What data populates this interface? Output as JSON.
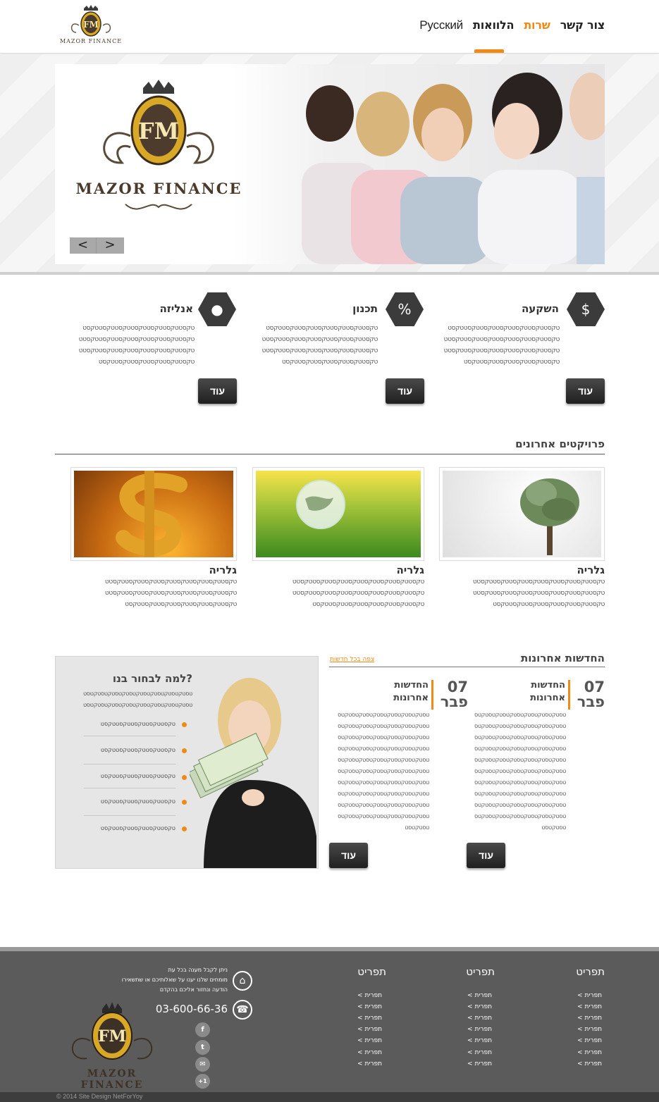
{
  "header": {
    "logo_text": "MAZOR FINANCE",
    "logo_monogram": "FM",
    "nav": [
      {
        "label": "צור קשר",
        "active": false
      },
      {
        "label": "שרות",
        "active": true
      },
      {
        "label": "הלוואות",
        "active": false
      },
      {
        "label": "Русский",
        "active": false
      }
    ]
  },
  "slider": {
    "logo_text": "MAZOR FINANCE",
    "logo_monogram": "FM",
    "prev_label": "<",
    "next_label": ">"
  },
  "features": [
    {
      "title": "השקעה",
      "icon": "money-bag-icon",
      "lines": [
        "טקסטטקסטטקסטטקסטטקסטטקסטטקסט",
        "טקסטטקסטטקסטטקסטטקסטטקסטטקסטט",
        "טקסטטקסטטקסטטקסטטקסטטקסטטקסטט",
        "טקסטטקסטטקסטטקסטטקסטטקסט"
      ],
      "button": "עוד"
    },
    {
      "title": "תכנון",
      "icon": "calculator-icon",
      "lines": [
        "טקסטטקסטטקסטטקסטטקסטטקסטטקסט",
        "טקסטטקסטטקסטטקסטטקסטטקסטטקסטט",
        "טקסטטקסטטקסטטקסטטקסטטקסטטקסטט",
        "טקסטטקסטטקסטטקסטטקסטטקסט"
      ],
      "button": "עוד"
    },
    {
      "title": "אנליזה",
      "icon": "piggy-bank-icon",
      "lines": [
        "טקסטטקסטטקסטטקסטטקסטטקסטטקסט",
        "טקסטטקסטטקסטטקסטטקסטטקסטטקסטט",
        "טקסטטקסטטקסטטקסטטקסטטקסטטקסטט",
        "טקסטטקסטטקסטטקסטטקסטטקסט"
      ],
      "button": "עוד"
    }
  ],
  "projects": {
    "title": "פרויקטים אחרונים",
    "items": [
      {
        "title": "גלריה",
        "image": "money-tree",
        "lines": [
          "טקסטטקסטטקסטטקסטטקסטטקסטטקסטטקסטט",
          "טקסטטקסטטקסטטקסטטקסטטקסטטקסטטקסטט",
          "טקסטטקסטטקסטטקסטטקסטטקסטטקסט"
        ]
      },
      {
        "title": "גלריה",
        "image": "glass-globe",
        "lines": [
          "טקסטטקסטטקסטטקסטטקסטטקסטטקסטטקסטט",
          "טקסטטקסטטקסטטקסטטקסטטקסטטקסטטקסטט",
          "טקסטטקסטטקסטטקסטטקסטטקסטטקסט"
        ]
      },
      {
        "title": "גלריה",
        "image": "golden-dollar",
        "lines": [
          "טקסטטקסטטקסטטקסטטקסטטקסטטקסטטקסטט",
          "טקסטטקסטטקסטטקסטטקסטטקסטטקסטטקסטט",
          "טקסטטקסטטקסטטקסטטקסטטקסטטקסט"
        ]
      }
    ]
  },
  "news": {
    "title": "החדשות אחרונות",
    "view_all": "צפה בכל חדשות",
    "items": [
      {
        "day": "07",
        "month": "פבר",
        "title_l1": "החדשות",
        "title_l2": "אחרונות",
        "lines": [
          "טסטקטסטקטסטקטסטקטסטקטסטקטס",
          "טסטקטסטקטסטקטסטקטסטקטסטקטס",
          "טסטקטסטקטסטקטסטקטסטקטסטקטס",
          "טסטקטסטקטסטקטסטקטסטקטסטקטס",
          "טסטקטסטקטסטקטסטקטסטקטסטקטס",
          "טסטקטסטקטסטקטסטקטסטקטסטקטס",
          "טסטקטסטקטסטקטסטקטסטקטסטקטס",
          "טסטקטסטקטסטקטסטקטסטקטסטקטס",
          "טסטקטסטקטסטקטסטקטסטקטסטקטס",
          "טסטקטסטקטסטקטסטקטסטקטסטקטס",
          "טסטקטסט"
        ],
        "button": "עוד"
      },
      {
        "day": "07",
        "month": "פבר",
        "title_l1": "החדשות",
        "title_l2": "אחרונות",
        "lines": [
          "טסטקטסטקטסטקטסטקטסטקטסטקטס",
          "טסטקטסטקטסטקטסטקטסטקטסטקטס",
          "טסטקטסטקטסטקטסטקטסטקטסטקטס",
          "טסטקטסטקטסטקטסטקטסטקטסטקטס",
          "טסטקטסטקטסטקטסטקטסטקטסטקטס",
          "טסטקטסטקטסטקטסטקטסטקטסטקטס",
          "טסטקטסטקטסטקטסטקטסטקטסטקטס",
          "טסטקטסטקטסטקטסטקטסטקטסטקטס",
          "טסטקטסטקטסטקטסטקטסטקטסטקטס",
          "טסטקטסטקטסטקטסטקטסטקטסטקטס",
          "טסטקטסט"
        ],
        "button": "עוד"
      }
    ]
  },
  "why": {
    "title": "למה לבחור בנו?",
    "intro": [
      "טסטקטסטקטסטקטסטקטסטקטסטקטסטקטסט",
      "טסטקטסטקטסטקטסטקטסטקטסטקטסטקטסט"
    ],
    "bullets": [
      "טקסטטקסטטקסטטקסטטקסט",
      "טקסטטקסטטקסטטקסטטקסט",
      "טקסטטקסטטקסטטקסטטקסט",
      "טקסטטקסטטקסטטקסטטקסט",
      "טקסטטקסטטקסטטקסטטקסט"
    ]
  },
  "footer": {
    "columns": [
      {
        "title": "תפריט",
        "items": [
          "תפרית >",
          "תפרית >",
          "תפרית >",
          "תפרית >",
          "תפרית >",
          "תפרית >",
          "תפרית >"
        ]
      },
      {
        "title": "תפריט",
        "items": [
          "תפרית >",
          "תפרית >",
          "תפרית >",
          "תפרית >",
          "תפרית >",
          "תפרית >",
          "תפרית >"
        ]
      },
      {
        "title": "תפריט",
        "items": [
          "תפרית >",
          "תפרית >",
          "תפרית >",
          "תפרית >",
          "תפרית >",
          "תפרית >",
          "תפרית >"
        ]
      }
    ],
    "contact_lines": [
      "ניתן לקבל מענה בכל עת",
      "מומחים שלנו יענו על שאלותיכם או שתשאירו",
      "הודעה ונחזור אליכם בהקדם"
    ],
    "phone": "03-600-66-36",
    "logo_text": "MAZOR FINANCE",
    "logo_monogram": "FM",
    "social": [
      "f",
      "t",
      "✉",
      "+1"
    ],
    "copyright": "© 2014 Site Design NetForYoy"
  }
}
